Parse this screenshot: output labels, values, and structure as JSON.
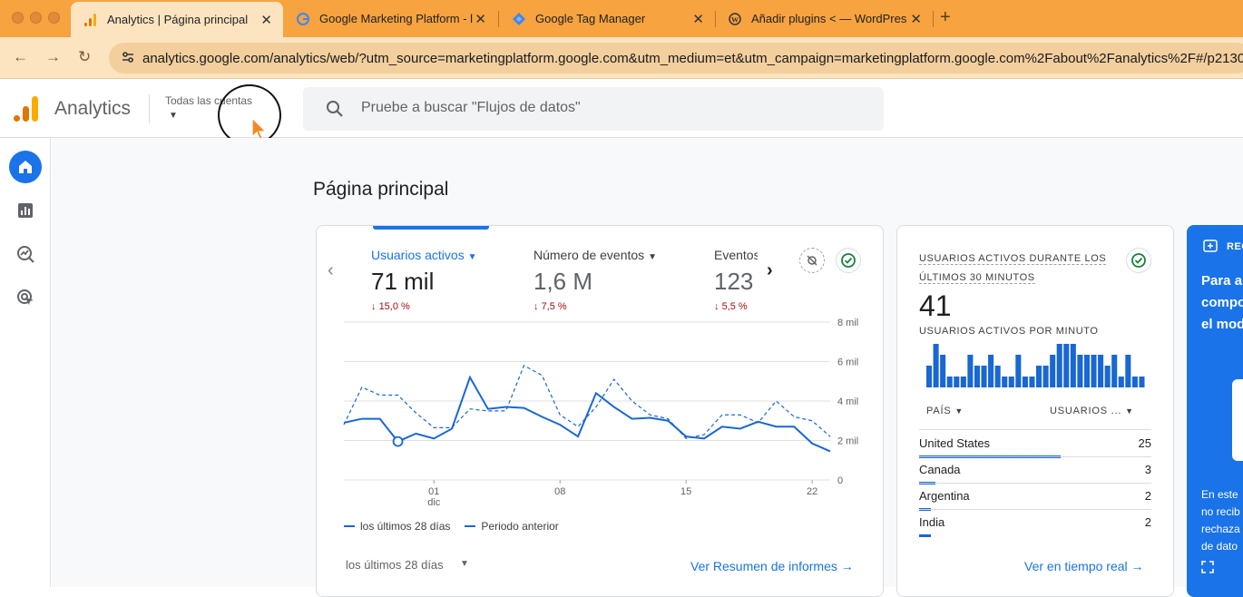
{
  "browser": {
    "tabs": [
      {
        "title": "Analytics | Página principal",
        "favicon": "analytics-favicon",
        "active": true
      },
      {
        "title": "Google Marketing Platform - l",
        "favicon": "google-g-favicon",
        "active": false
      },
      {
        "title": "Google Tag Manager",
        "favicon": "tag-manager-favicon",
        "active": false
      },
      {
        "title": "Añadir plugins < — WordPres",
        "favicon": "wordpress-favicon",
        "active": false
      }
    ],
    "url": "analytics.google.com/analytics/web/?utm_source=marketingplatform.google.com&utm_medium=et&utm_campaign=marketingplatform.google.com%2Fabout%2Fanalytics%2F#/p2130"
  },
  "header": {
    "app_name": "Analytics",
    "account_label": "Todas las cuentas",
    "search_placeholder": "Pruebe a buscar \"Flujos de datos\""
  },
  "page": {
    "title": "Página principal"
  },
  "overview_card": {
    "metrics": [
      {
        "label": "Usuarios activos",
        "value": "71 mil",
        "delta": "15,0 %",
        "selected": true
      },
      {
        "label": "Número de eventos",
        "value": "1,6 M",
        "delta": "7,5 %",
        "selected": false
      },
      {
        "label": "Eventos",
        "value": "123",
        "delta": "5,5 %",
        "selected": false
      }
    ],
    "legend": {
      "current": "los últimos 28 días",
      "previous": "Periodo anterior"
    },
    "period_selector": "los últimos 28 días",
    "link": "Ver Resumen de informes"
  },
  "chart_data": {
    "type": "line",
    "x_ticks": [
      "01",
      "08",
      "15",
      "22"
    ],
    "x_sub_label": "dic",
    "y_ticks": [
      "8 mil",
      "6 mil",
      "4 mil",
      "2 mil",
      "0"
    ],
    "ylim": [
      0,
      8000
    ],
    "grid": true,
    "series": [
      {
        "name": "los últimos 28 días",
        "style": "solid",
        "values": [
          2900,
          3100,
          3100,
          1950,
          2350,
          2100,
          2600,
          5200,
          3600,
          3700,
          3650,
          3200,
          2800,
          2200,
          4400,
          3700,
          3100,
          3150,
          3000,
          2200,
          2100,
          2700,
          2600,
          2950,
          2700,
          2700,
          1850,
          1450
        ]
      },
      {
        "name": "Periodo anterior",
        "style": "dashed",
        "values": [
          2800,
          4700,
          4300,
          4300,
          3400,
          2650,
          2650,
          3600,
          3500,
          3500,
          5800,
          5300,
          3300,
          2700,
          3700,
          5100,
          4000,
          3300,
          3100,
          2100,
          2300,
          3300,
          3300,
          2900,
          4000,
          3200,
          3000,
          2200
        ]
      }
    ],
    "highlight_index": 3,
    "colors": {
      "line": "#1967d2",
      "grid": "#e0e0e0"
    }
  },
  "realtime_card": {
    "title": "USUARIOS ACTIVOS DURANTE LOS ÚLTIMOS 30 MINUTOS",
    "value": "41",
    "per_minute_label": "USUARIOS ACTIVOS POR MINUTO",
    "per_minute_values": [
      2,
      4,
      3,
      1,
      1,
      1,
      3,
      2,
      2,
      3,
      2,
      1,
      1,
      3,
      1,
      1,
      2,
      2,
      3,
      4,
      4,
      4,
      3,
      3,
      3,
      3,
      2,
      3,
      1,
      3,
      1,
      1
    ],
    "col_country": "PAÍS",
    "col_users": "USUARIOS ...",
    "rows": [
      {
        "country": "United States",
        "users": "25",
        "share": 0.61
      },
      {
        "country": "Canada",
        "users": "3",
        "share": 0.07
      },
      {
        "country": "Argentina",
        "users": "2",
        "share": 0.05
      },
      {
        "country": "India",
        "users": "2",
        "share": 0.05
      }
    ],
    "link": "Ver en tiempo real"
  },
  "promo_card": {
    "head": "REC",
    "body": [
      "Para a",
      "compo",
      "el mod"
    ],
    "foot": [
      "En este",
      "no recib",
      "rechaza",
      "de dato"
    ]
  },
  "colors": {
    "brand_blue": "#1a73e8",
    "tabbar": "#f6a340",
    "negative": "#a50e0e",
    "success": "#188038"
  }
}
